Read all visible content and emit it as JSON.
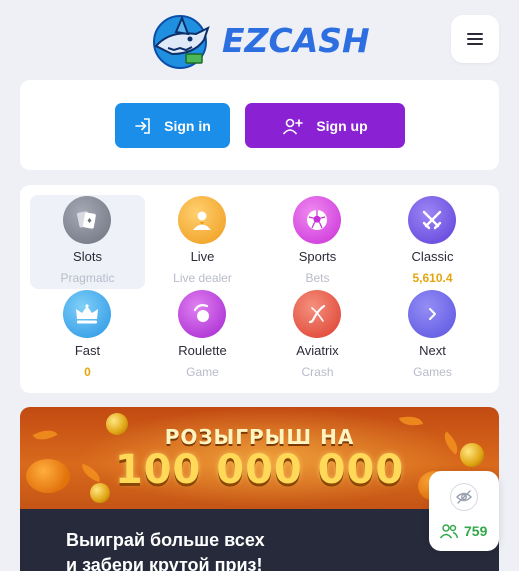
{
  "header": {
    "logo_text": "EZCASH"
  },
  "auth": {
    "signin_label": "Sign in",
    "signup_label": "Sign up"
  },
  "categories": [
    {
      "title": "Slots",
      "sub": "Pragmatic",
      "icon": "cards-icon",
      "color": "#8a8d99"
    },
    {
      "title": "Live",
      "sub": "Live dealer",
      "icon": "dealer-icon",
      "color": "#f0a22a"
    },
    {
      "title": "Sports",
      "sub": "Bets",
      "icon": "soccer-ball-icon",
      "color": "#d43fe0"
    },
    {
      "title": "Classic",
      "sub": "5,610.4",
      "icon": "crossed-swords-icon",
      "color": "#6b4fe0"
    },
    {
      "title": "Fast",
      "sub": "0",
      "icon": "crown-icon",
      "color": "#2d9be8"
    },
    {
      "title": "Roulette",
      "sub": "Game",
      "icon": "roulette-icon",
      "color": "#b42fdc"
    },
    {
      "title": "Aviatrix",
      "sub": "Crash",
      "icon": "aviatrix-icon",
      "color": "#e24a3a"
    },
    {
      "title": "Next",
      "sub": "Games",
      "icon": "chevron-right-icon",
      "color": "#6a63e6"
    }
  ],
  "banner": {
    "promo_title": "РОЗЫГРЫШ НА",
    "promo_amount": "100 000 000",
    "line1": "Выиграй больше всех",
    "line2": "и забери крутой приз!"
  },
  "online": {
    "count": "759"
  },
  "colors": {
    "brand": "#2d6fe0",
    "signin": "#1a8ee8",
    "signup": "#8a22d4",
    "online": "#33a84b",
    "accent": "#e5a50e"
  }
}
